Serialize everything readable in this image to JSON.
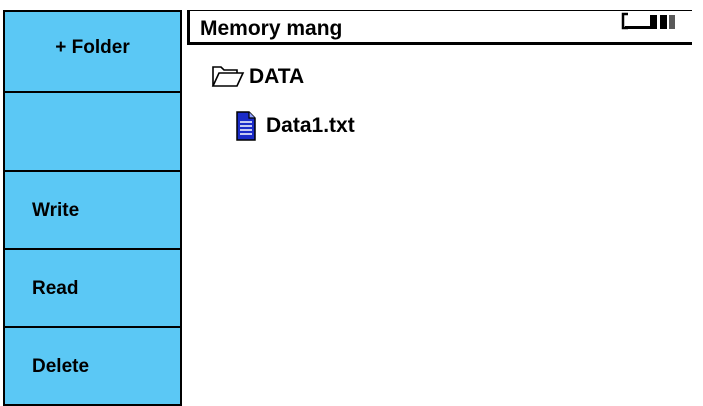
{
  "sidebar": {
    "buttons": [
      {
        "label": "+ Folder"
      },
      {
        "label": ""
      },
      {
        "label": "Write"
      },
      {
        "label": "Read"
      },
      {
        "label": "Delete"
      }
    ]
  },
  "header": {
    "title": "Memory mang",
    "battery_icon": "battery-icon"
  },
  "tree": {
    "folder": {
      "label": "DATA",
      "icon": "folder-icon"
    },
    "file": {
      "label": "Data1.txt",
      "icon": "document-icon"
    }
  },
  "colors": {
    "button_bg": "#5bc8f5",
    "file_icon": "#1a2bc8"
  }
}
